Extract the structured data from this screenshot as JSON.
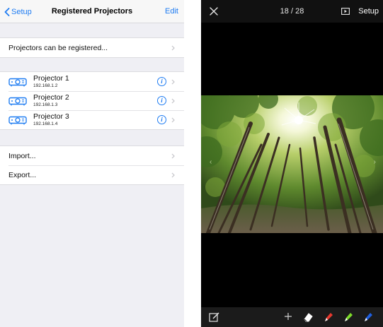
{
  "left": {
    "nav": {
      "back_label": "Setup",
      "title": "Registered Projectors",
      "edit_label": "Edit"
    },
    "register_label": "Projectors can be registered...",
    "projectors": [
      {
        "name": "Projector 1",
        "ip": "192.168.1.2"
      },
      {
        "name": "Projector 2",
        "ip": "192.168.1.3"
      },
      {
        "name": "Projector 3",
        "ip": "192.168.1.4"
      }
    ],
    "import_label": "Import...",
    "export_label": "Export..."
  },
  "right": {
    "counter": "18 / 28",
    "setup_label": "Setup",
    "toolbar": {
      "tools": [
        "edit-icon",
        "plus-icon",
        "eraser-icon",
        "red-marker-icon",
        "green-marker-icon",
        "blue-marker-icon"
      ],
      "marker_colors": [
        "#e8392f",
        "#7ddc2a",
        "#1f5fe0"
      ]
    }
  },
  "colors": {
    "accent": "#1e7cf2",
    "left_background": "#efeff4",
    "viewer_background": "#000000"
  }
}
